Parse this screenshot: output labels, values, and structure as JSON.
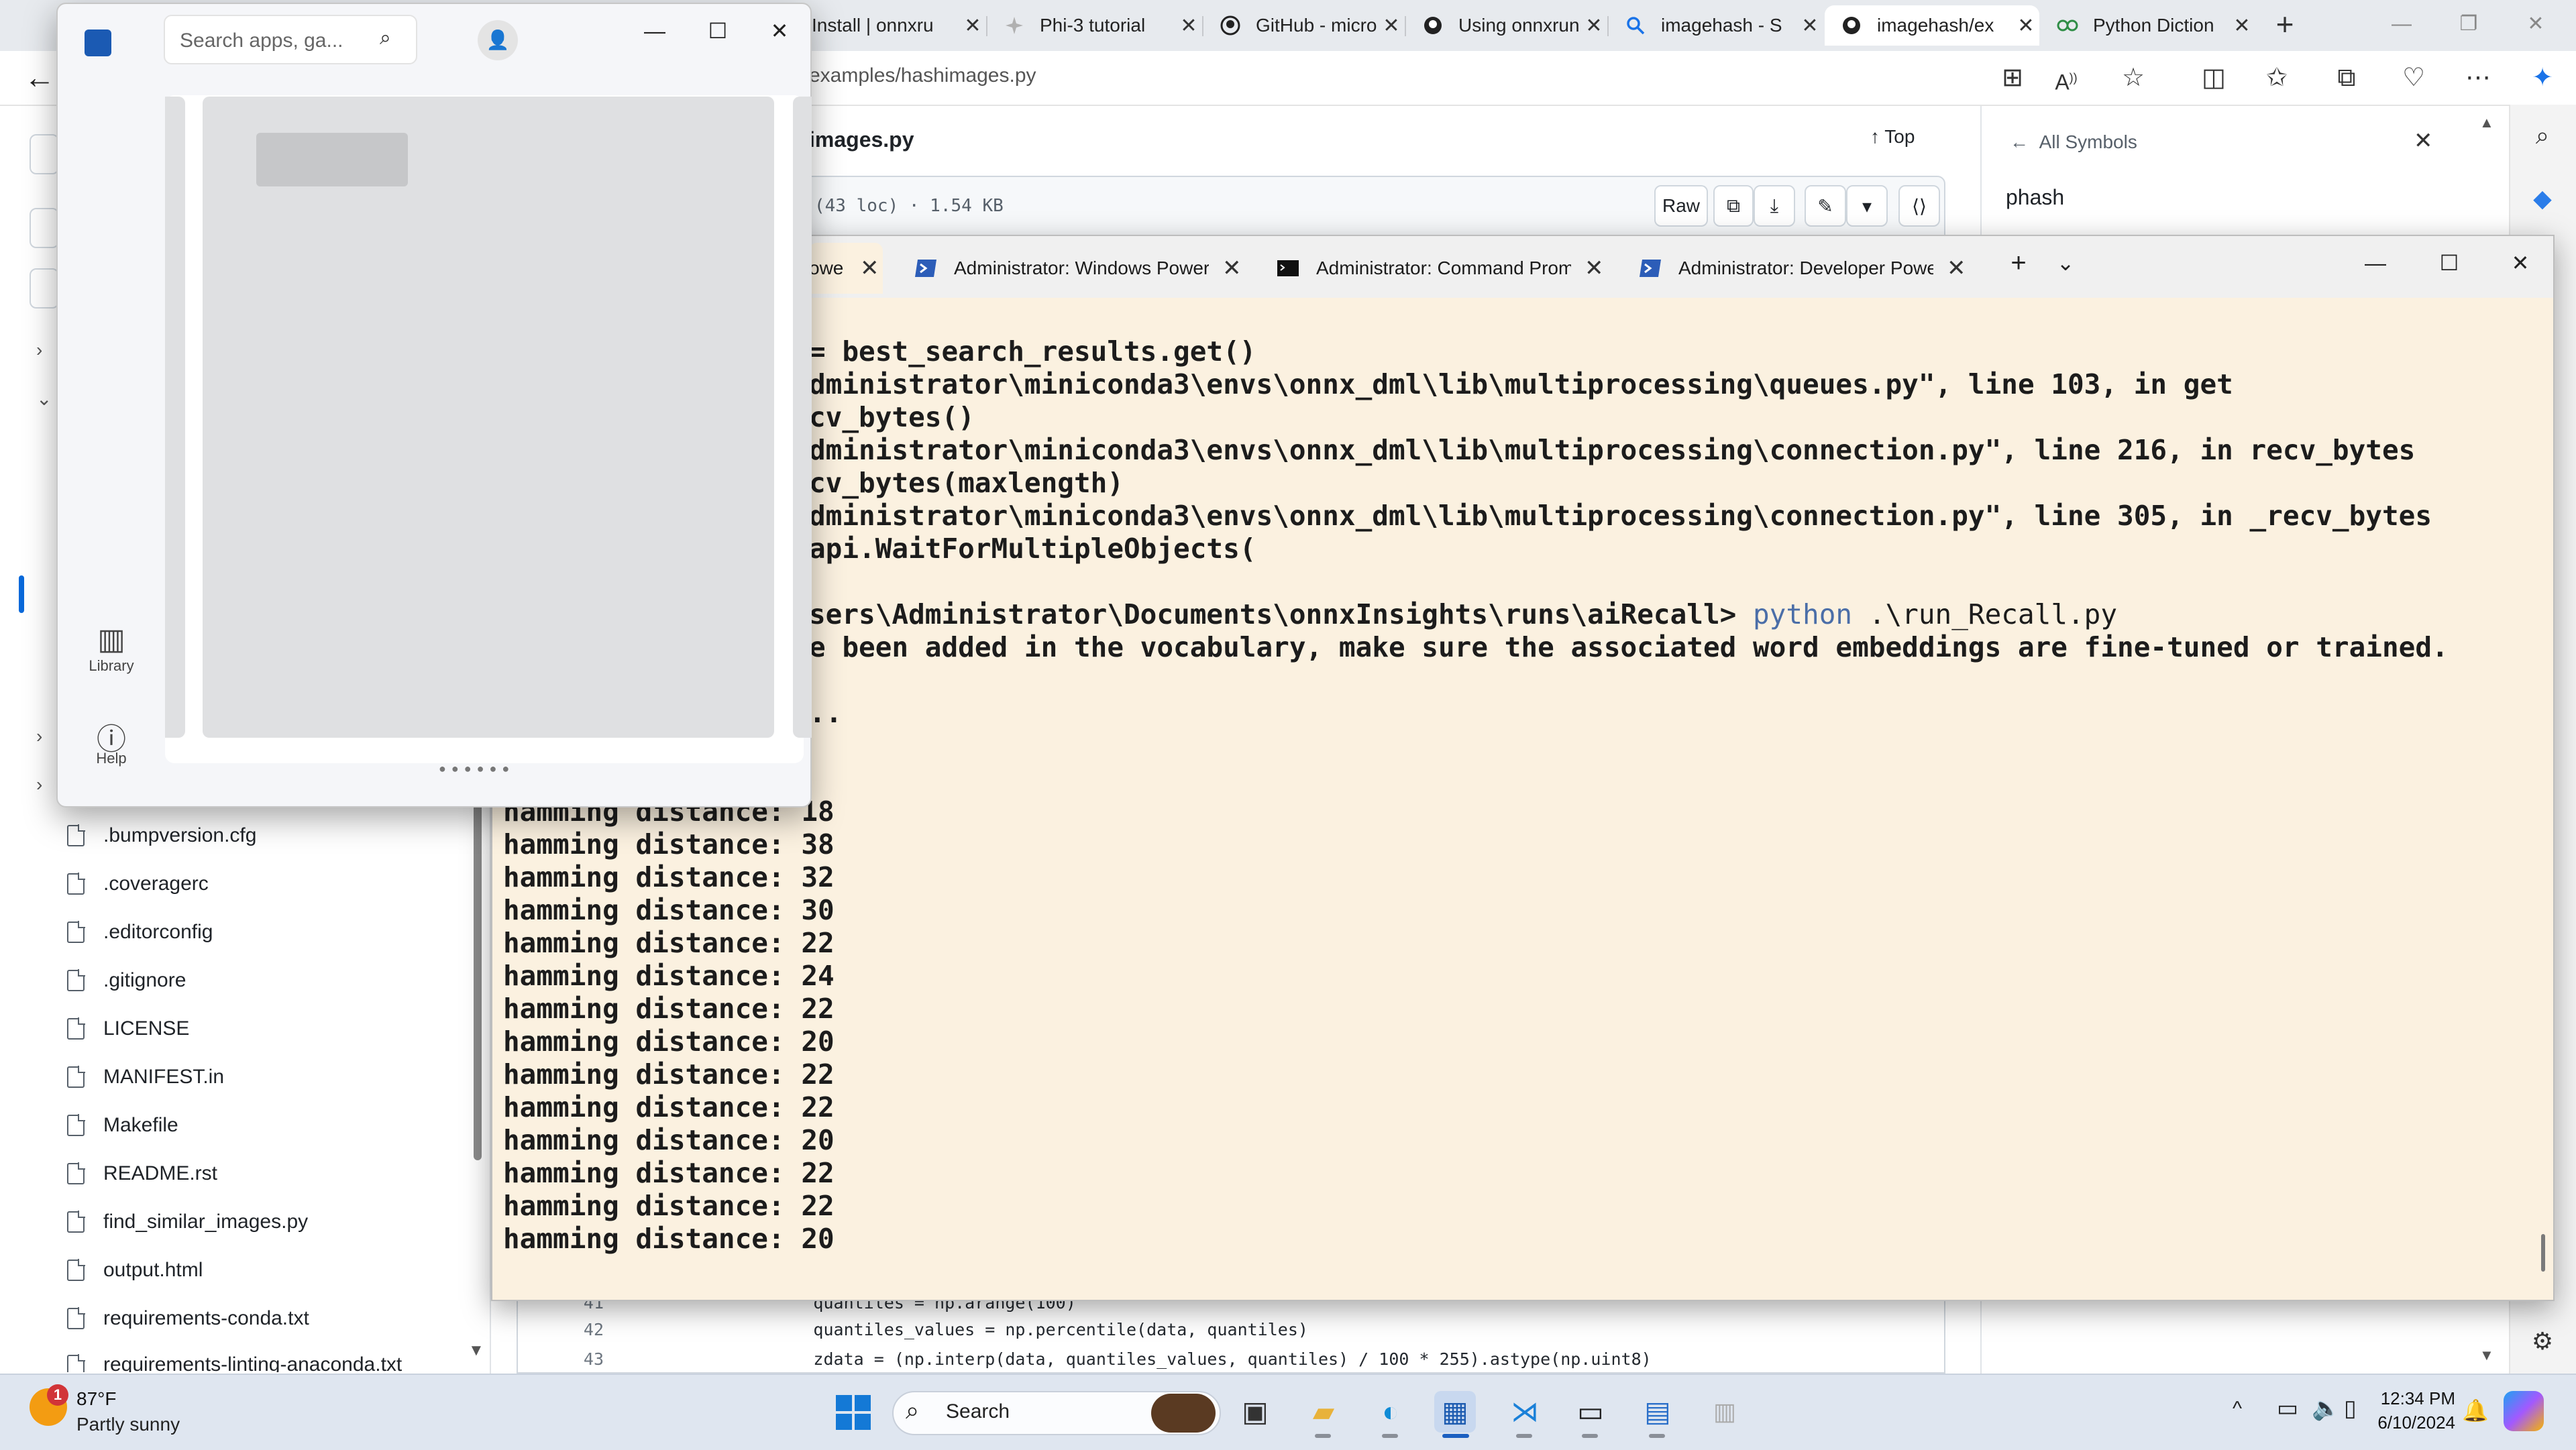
{
  "browser": {
    "tabs": [
      {
        "label": "Install | onnxru",
        "icon": "onnx-icon"
      },
      {
        "label": "Phi-3 tutorial",
        "icon": "phi-icon"
      },
      {
        "label": "GitHub - micro",
        "icon": "github-icon"
      },
      {
        "label": "Using onnxrun",
        "icon": "github-icon"
      },
      {
        "label": "imagehash - S",
        "icon": "search-icon"
      },
      {
        "label": "imagehash/ex",
        "icon": "github-icon"
      },
      {
        "label": "Python Diction",
        "icon": "gfg-icon"
      }
    ],
    "url": "examples/hashimages.py"
  },
  "github": {
    "file_title": "images.py",
    "top_label": "Top",
    "loc_info": "(43 loc) · 1.54 KB",
    "raw_label": "Raw",
    "symbols_back": "All Symbols",
    "symbol_query": "phash",
    "files": [
      ".bumpversion.cfg",
      ".coveragerc",
      ".editorconfig",
      ".gitignore",
      "LICENSE",
      "MANIFEST.in",
      "Makefile",
      "README.rst",
      "find_similar_images.py",
      "output.html",
      "requirements-conda.txt",
      "requirements-linting-anaconda.txt"
    ],
    "code_lines": [
      {
        "num": "41",
        "text": "        quantiles = np.arange(100)"
      },
      {
        "num": "42",
        "text": "        quantiles_values = np.percentile(data, quantiles)"
      },
      {
        "num": "43",
        "text": "        zdata = (np.interp(data, quantiles_values, quantiles) / 100 * 255).astype(np.uint8)"
      }
    ]
  },
  "terminal": {
    "tabs": [
      {
        "label": "owe",
        "icon": "powershell-icon"
      },
      {
        "label": "Administrator: Windows Power",
        "icon": "powershell-icon"
      },
      {
        "label": "Administrator: Command Prom",
        "icon": "cmd-icon"
      },
      {
        "label": "Administrator: Developer Powe",
        "icon": "powershell-icon"
      }
    ],
    "lines": [
      "= best_search_results.get()",
      "dministrator\\miniconda3\\envs\\onnx_dml\\lib\\multiprocessing\\queues.py\", line 103, in get",
      "cv_bytes()",
      "dministrator\\miniconda3\\envs\\onnx_dml\\lib\\multiprocessing\\connection.py\", line 216, in recv_bytes",
      "cv_bytes(maxlength)",
      "dministrator\\miniconda3\\envs\\onnx_dml\\lib\\multiprocessing\\connection.py\", line 305, in _recv_bytes",
      "api.WaitForMultipleObjects(",
      "",
      "sers\\Administrator\\Documents\\onnxInsights\\runs\\aiRecall> ",
      "e been added in the vocabulary, make sure the associated word embeddings are fine-tuned or trained.",
      "",
      ".."
    ],
    "prompt_cmd": "python",
    "prompt_arg": " .\\run_Recall.py",
    "hamming_label": "hamming distance: ",
    "hamming_values": [
      "18",
      "38",
      "32",
      "30",
      "22",
      "24",
      "22",
      "20",
      "22",
      "22",
      "20",
      "22",
      "22",
      "20"
    ]
  },
  "store": {
    "search_placeholder": "Search apps, ga...",
    "nav_library": "Library",
    "nav_help": "Help"
  },
  "taskbar": {
    "weather_badge": "1",
    "temperature": "87°F",
    "weather": "Partly sunny",
    "search_label": "Search",
    "time": "12:34 PM",
    "date": "6/10/2024"
  }
}
